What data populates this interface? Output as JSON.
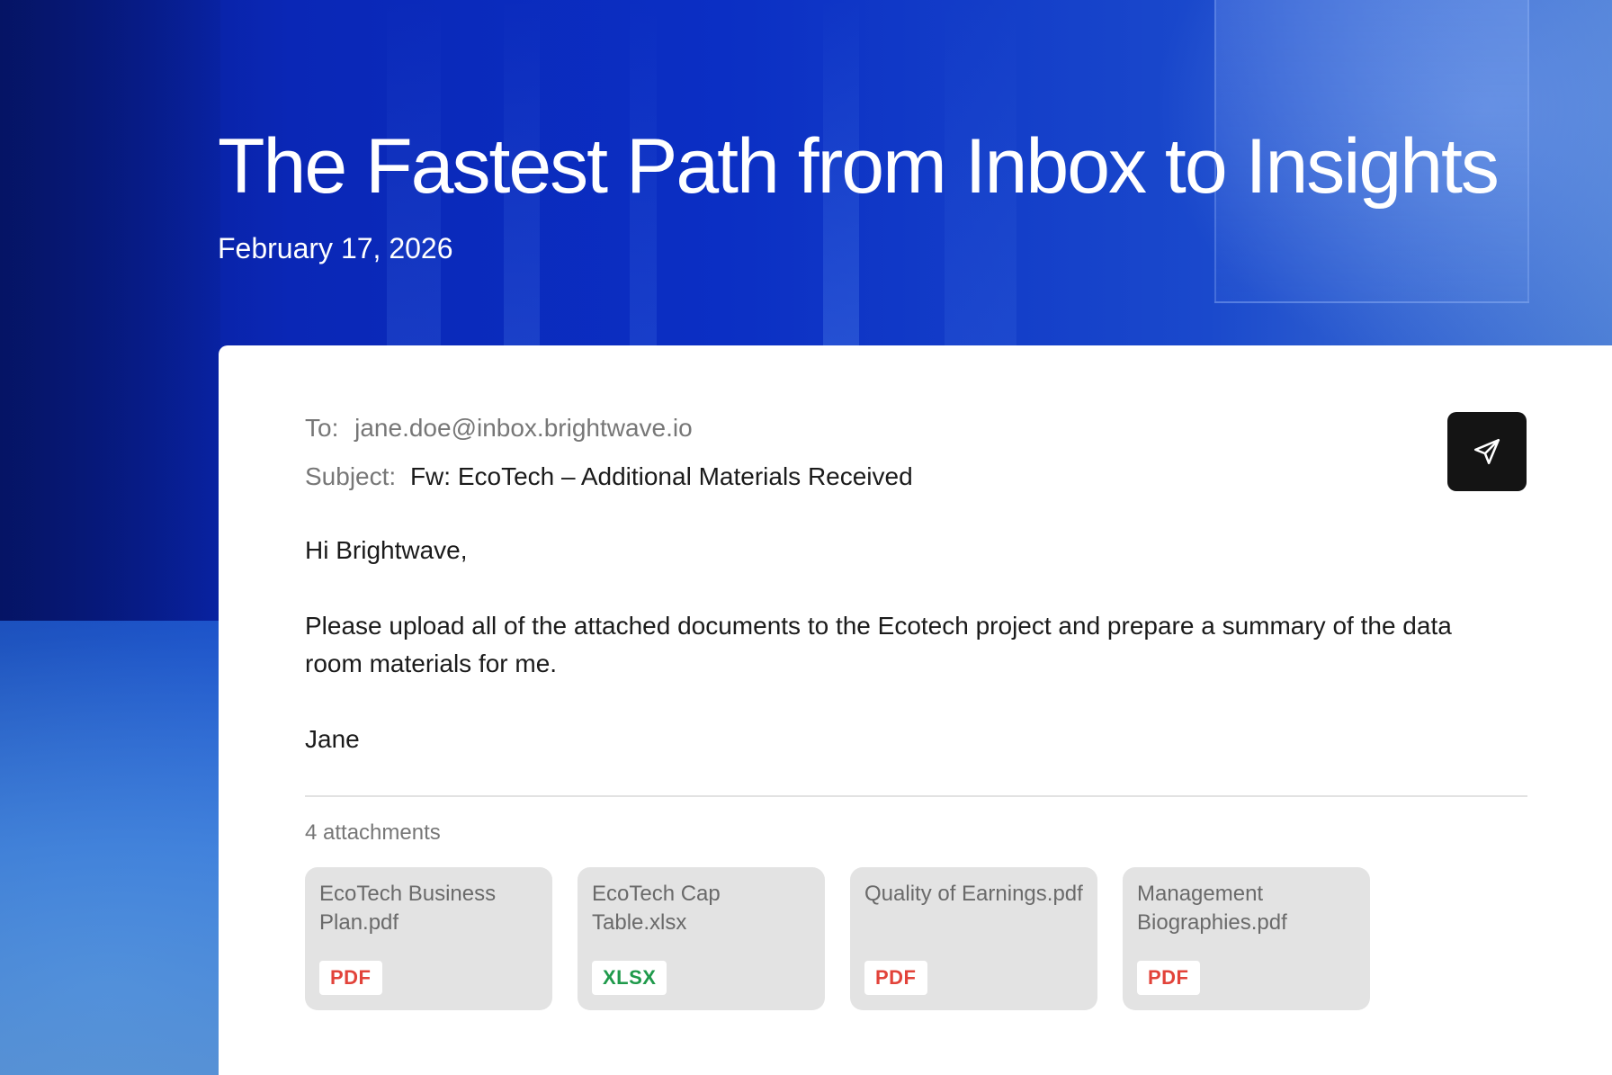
{
  "hero": {
    "title": "The Fastest Path from Inbox to Insights",
    "date": "February 17, 2026"
  },
  "email": {
    "to_label": "To:",
    "to_value": "jane.doe@inbox.brightwave.io",
    "subject_label": "Subject:",
    "subject_value": "Fw: EcoTech – Additional Materials Received",
    "greeting": "Hi Brightwave,",
    "message": "Please upload all of the attached documents to the Ecotech project and prepare a summary of the data room materials for me.",
    "signoff": "Jane",
    "send_icon": "send-icon"
  },
  "attachments": {
    "count_label": "4 attachments",
    "items": [
      {
        "name": "EcoTech Business Plan.pdf",
        "type": "PDF",
        "type_color": "#e2433a"
      },
      {
        "name": "EcoTech Cap Table.xlsx",
        "type": "XLSX",
        "type_color": "#1f9a4b"
      },
      {
        "name": "Quality of Earnings.pdf",
        "type": "PDF",
        "type_color": "#e2433a"
      },
      {
        "name": "Management Biographies.pdf",
        "type": "PDF",
        "type_color": "#e2433a"
      }
    ]
  },
  "colors": {
    "background_blue": "#0b2fc4",
    "send_button": "#141414",
    "attachment_card": "#e3e3e3"
  }
}
